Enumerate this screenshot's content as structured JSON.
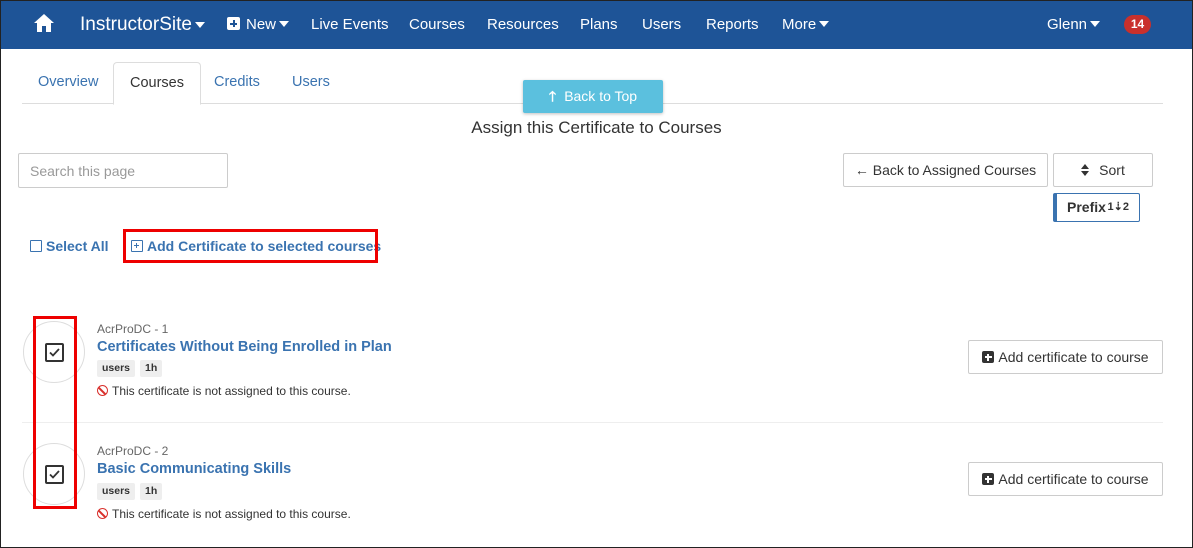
{
  "navbar": {
    "brand": "InstructorSite",
    "new_label": "New",
    "links": [
      "Live Events",
      "Courses",
      "Resources",
      "Plans",
      "Users",
      "Reports"
    ],
    "more_label": "More",
    "user_label": "Glenn",
    "notification_count": "14",
    "background": "#1e5497"
  },
  "tabs": [
    "Overview",
    "Courses",
    "Credits",
    "Users"
  ],
  "active_tab": "Courses",
  "back_to_top": "Back to Top",
  "page_title": "Assign this Certificate to Courses",
  "search": {
    "placeholder": "Search this page",
    "value": ""
  },
  "buttons": {
    "back_to_assigned": "Back to Assigned Courses",
    "sort": "Sort",
    "sort_field": "Prefix",
    "sort_dir_icon": "1⇣2"
  },
  "bulk": {
    "select_all": "Select All",
    "add_selected": "Add Certificate to selected courses"
  },
  "courses": [
    {
      "prefix": "AcrProDC - 1",
      "title": "Certificates Without Being Enrolled in Plan",
      "tags": [
        "users",
        "1h"
      ],
      "status": "This certificate is not assigned to this course.",
      "checked": true,
      "action": "Add certificate to course"
    },
    {
      "prefix": "AcrProDC - 2",
      "title": "Basic Communicating Skills",
      "tags": [
        "users",
        "1h"
      ],
      "status": "This certificate is not assigned to this course.",
      "checked": true,
      "action": "Add certificate to course"
    }
  ],
  "colors": {
    "link": "#3a73b0",
    "highlight": "#ee0000",
    "back_to_top": "#5bc0de",
    "badge": "#c9302c"
  }
}
